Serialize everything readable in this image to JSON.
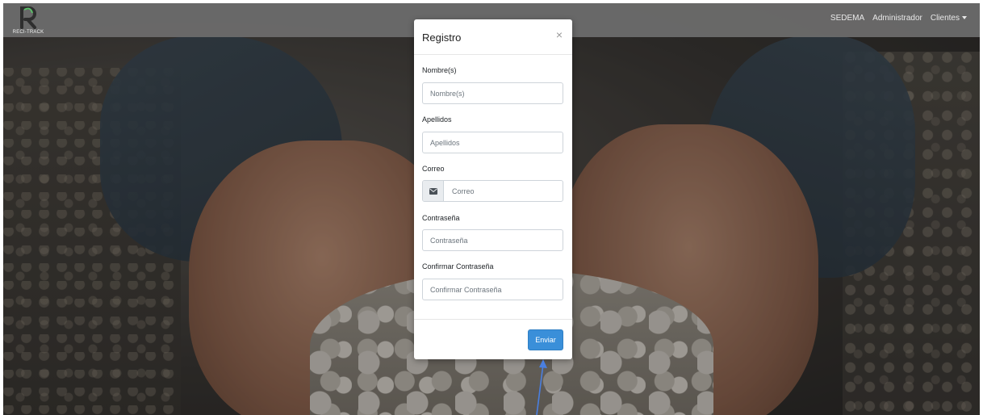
{
  "brand": {
    "logo_text": "RECI-TRACK"
  },
  "nav": {
    "links": [
      {
        "label": "SEDEMA"
      },
      {
        "label": "Administrador"
      },
      {
        "label": "Clientes"
      }
    ]
  },
  "modal": {
    "title": "Registro",
    "close_symbol": "×",
    "fields": [
      {
        "label": "Nombre(s)",
        "placeholder": "Nombre(s)"
      },
      {
        "label": "Apellidos",
        "placeholder": "Apellidos"
      },
      {
        "label": "Correo",
        "placeholder": "Correo",
        "icon": "envelope-icon"
      },
      {
        "label": "Contraseña",
        "placeholder": "Contraseña"
      },
      {
        "label": "Confirmar Contraseña",
        "placeholder": "Confirmar Contraseña"
      }
    ],
    "submit_label": "Enviar"
  },
  "colors": {
    "primary": "#3a8fd9",
    "navbar": "#6e6e6e",
    "annotation_arrow": "#4a7fe0"
  }
}
